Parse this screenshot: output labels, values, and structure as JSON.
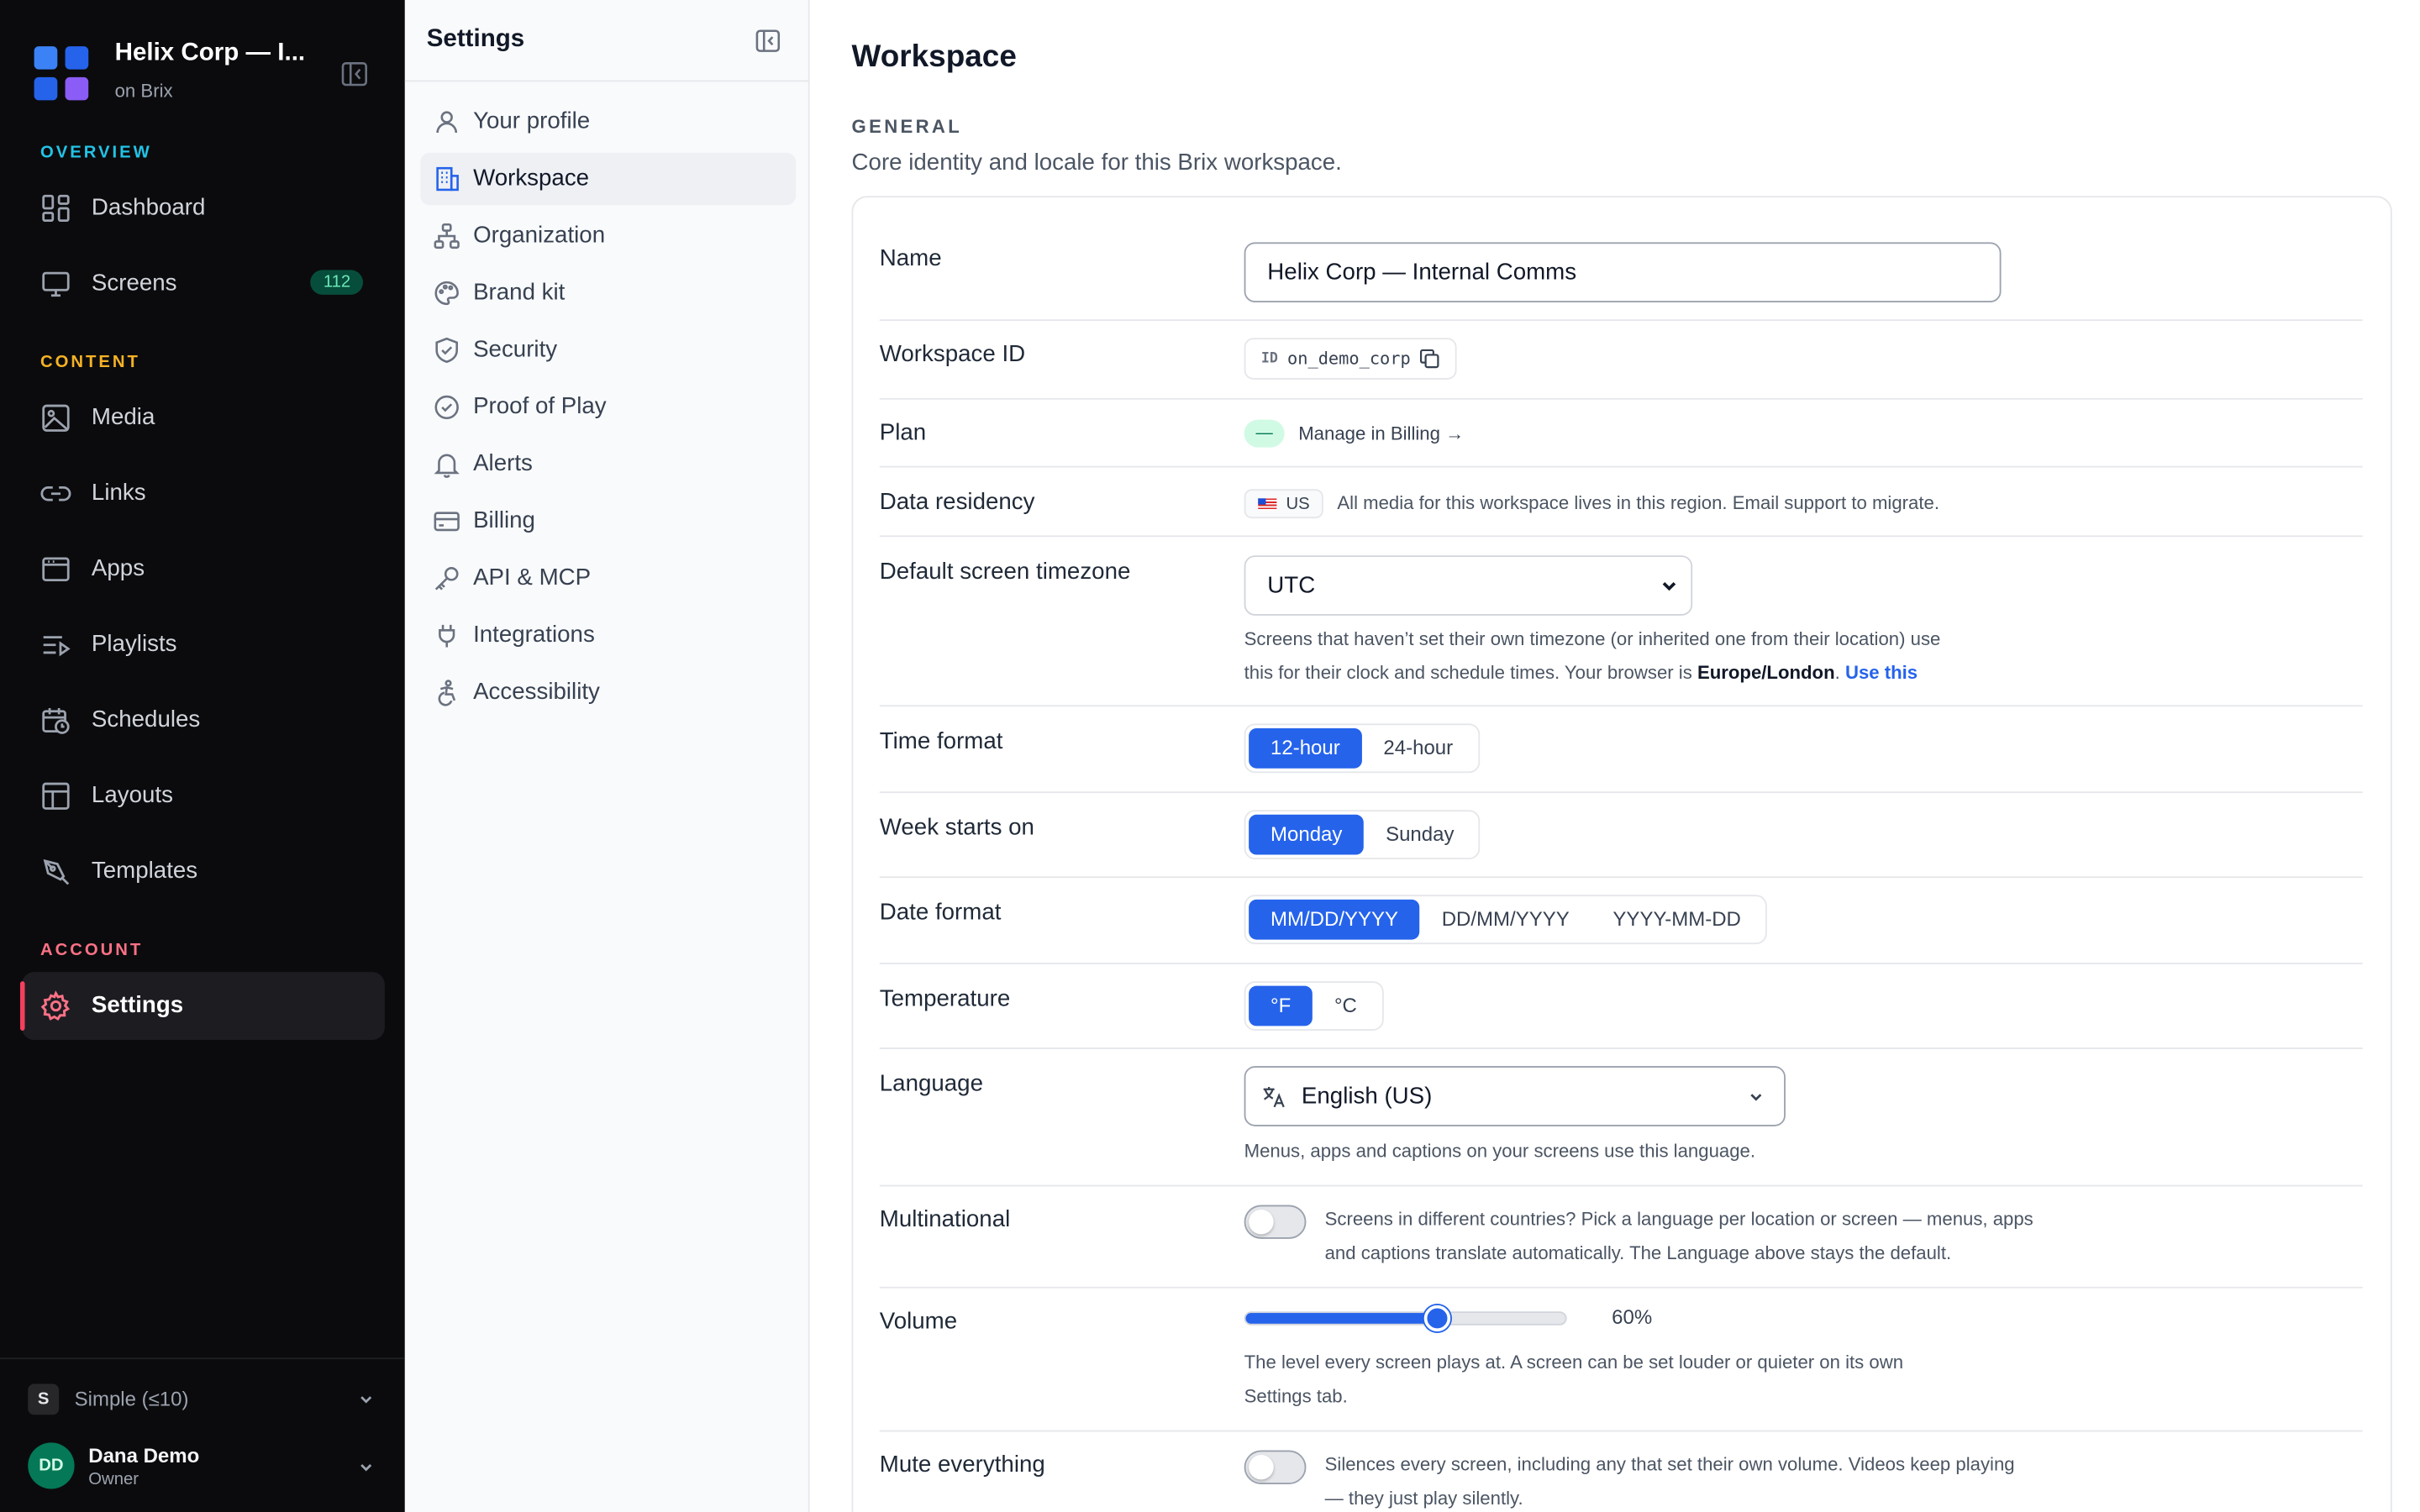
{
  "workspace": {
    "name": "Helix Corp — I...",
    "sub": "on Brix"
  },
  "sidebar": {
    "sections": {
      "overview": "OVERVIEW",
      "content": "CONTENT",
      "account": "ACCOUNT"
    },
    "section_colors": {
      "overview": "#22c3e6",
      "content": "#f5b225",
      "account": "#fb7185"
    },
    "items": [
      {
        "label": "Dashboard",
        "icon": "grid-icon"
      },
      {
        "label": "Screens",
        "icon": "monitor-icon",
        "badge": "112"
      },
      {
        "label": "Media",
        "icon": "image-icon"
      },
      {
        "label": "Links",
        "icon": "link-icon"
      },
      {
        "label": "Apps",
        "icon": "app-window-icon"
      },
      {
        "label": "Playlists",
        "icon": "playlist-icon"
      },
      {
        "label": "Schedules",
        "icon": "calendar-clock-icon"
      },
      {
        "label": "Layouts",
        "icon": "layout-icon"
      },
      {
        "label": "Templates",
        "icon": "pen-tool-icon"
      },
      {
        "label": "Settings",
        "icon": "gear-icon",
        "active": true
      }
    ],
    "plan": {
      "letter": "S",
      "label": "Simple (≤10)"
    },
    "user": {
      "initials": "DD",
      "name": "Dana Demo",
      "role": "Owner"
    }
  },
  "settings_nav": {
    "title": "Settings",
    "items": [
      {
        "label": "Your profile",
        "icon": "user-icon"
      },
      {
        "label": "Workspace",
        "icon": "building-icon",
        "active": true
      },
      {
        "label": "Organization",
        "icon": "org-chart-icon"
      },
      {
        "label": "Brand kit",
        "icon": "palette-icon"
      },
      {
        "label": "Security",
        "icon": "shield-icon"
      },
      {
        "label": "Proof of Play",
        "icon": "check-circle-icon"
      },
      {
        "label": "Alerts",
        "icon": "bell-icon"
      },
      {
        "label": "Billing",
        "icon": "credit-card-icon"
      },
      {
        "label": "API & MCP",
        "icon": "key-icon"
      },
      {
        "label": "Integrations",
        "icon": "plug-icon"
      },
      {
        "label": "Accessibility",
        "icon": "accessibility-icon"
      }
    ]
  },
  "main": {
    "title": "Workspace",
    "section": "GENERAL",
    "section_desc": "Core identity and locale for this Brix workspace.",
    "fields": {
      "name": {
        "label": "Name",
        "value": "Helix Corp — Internal Comms"
      },
      "workspace_id": {
        "label": "Workspace ID",
        "tag": "ID",
        "value": "on_demo_corp"
      },
      "plan": {
        "label": "Plan",
        "pill": "—",
        "link": "Manage in Billing →"
      },
      "data_residency": {
        "label": "Data residency",
        "region": "US",
        "desc": "All media for this workspace lives in this region. Email support to migrate."
      },
      "timezone": {
        "label": "Default screen timezone",
        "value": "UTC",
        "help_1": "Screens that haven’t set their own timezone (or inherited one from their location) use",
        "help_2a": "this for their clock and schedule times. Your browser is ",
        "help_2b": "Europe/London",
        "help_2c": ". ",
        "help_link": "Use this"
      },
      "time_format": {
        "label": "Time format",
        "options": [
          "12-hour",
          "24-hour"
        ],
        "selected": "12-hour"
      },
      "week_start": {
        "label": "Week starts on",
        "options": [
          "Monday",
          "Sunday"
        ],
        "selected": "Monday"
      },
      "date_format": {
        "label": "Date format",
        "options": [
          "MM/DD/YYYY",
          "DD/MM/YYYY",
          "YYYY-MM-DD"
        ],
        "selected": "MM/DD/YYYY"
      },
      "temperature": {
        "label": "Temperature",
        "options": [
          "°F",
          "°C"
        ],
        "selected": "°F"
      },
      "language": {
        "label": "Language",
        "value": "English (US)",
        "help": "Menus, apps and captions on your screens use this language."
      },
      "multinational": {
        "label": "Multinational",
        "enabled": false,
        "desc_1": "Screens in different countries? Pick a language per location or screen — menus, apps",
        "desc_2": "and captions translate automatically. The Language above stays the default."
      },
      "volume": {
        "label": "Volume",
        "value": 60,
        "value_text": "60%",
        "help_1": "The level every screen plays at. A screen can be set louder or quieter on its own",
        "help_2": "Settings tab."
      },
      "mute": {
        "label": "Mute everything",
        "enabled": false,
        "desc_1": "Silences every screen, including any that set their own volume. Videos keep playing",
        "desc_2": "— they just play silently."
      }
    }
  }
}
